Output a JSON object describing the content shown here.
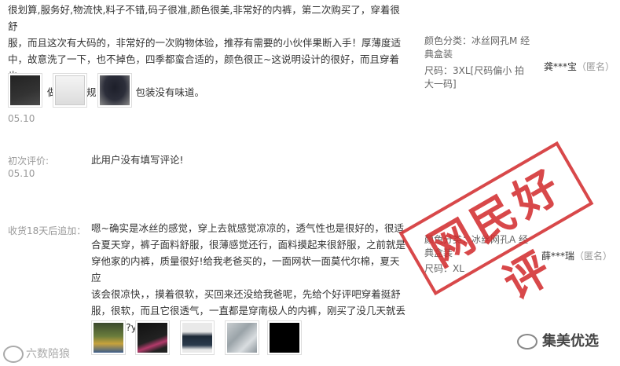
{
  "review1": {
    "text": "很划算,服务好,物流快,料子不错,码子很准,颜色很美,非常好的内裤，第二次购买了，穿着很舒\n服，而且这次有大码的，非常好的一次购物体验，推荐有需要的小伙伴果断入手！厚薄度适\n中，故意洗了一下，也不掉色，四季都蛮合适的，颜色很正~这说明设计的很好，而且穿着也\n很合身，做的很正规！满意！包装没有味道。",
    "date": "05.10",
    "spec_color": "颜色分类：冰丝网孔M 经\n典盒装",
    "spec_size": "尺码：3XL[尺码偏小 拍\n大一码]",
    "user": "龚***宝",
    "user_tag": "（匿名）"
  },
  "review2": {
    "first_label": "初次评价:",
    "first_date": "05.10",
    "first_text": "此用户没有填写评论!",
    "append_label": "收货18天后追加：",
    "append_text": "嗯~确实是冰丝的感觉，穿上去就感觉凉凉的，透气性也是很好的，很适\n合夏天穿，裤子面料舒服，很薄感觉还行，面料摸起来很舒服，之前就是\n穿他家的内裤，质量很好!给我老爸买的，一面网状一面莫代尔棉，夏天应\n该会很凉快，，摸着很软，买回来还没给我爸呢，先给个好评吧穿着挺舒\n服，很软，而且它很透气，一直都是穿南极人的内裤，刚买了没几天就丢\n了一条??yy",
    "spec_color": "颜色分类：冰丝网孔A 经\n典盒装",
    "spec_size": "尺码：XL",
    "user": "薛***瑞",
    "user_tag": "（匿名）"
  },
  "stamp_text": "网民好评",
  "watermark_left": "六数陪狼",
  "watermark_right": "集美优选",
  "colors": {
    "stamp": "#d2292b",
    "label": "#999999",
    "text": "#333333"
  }
}
